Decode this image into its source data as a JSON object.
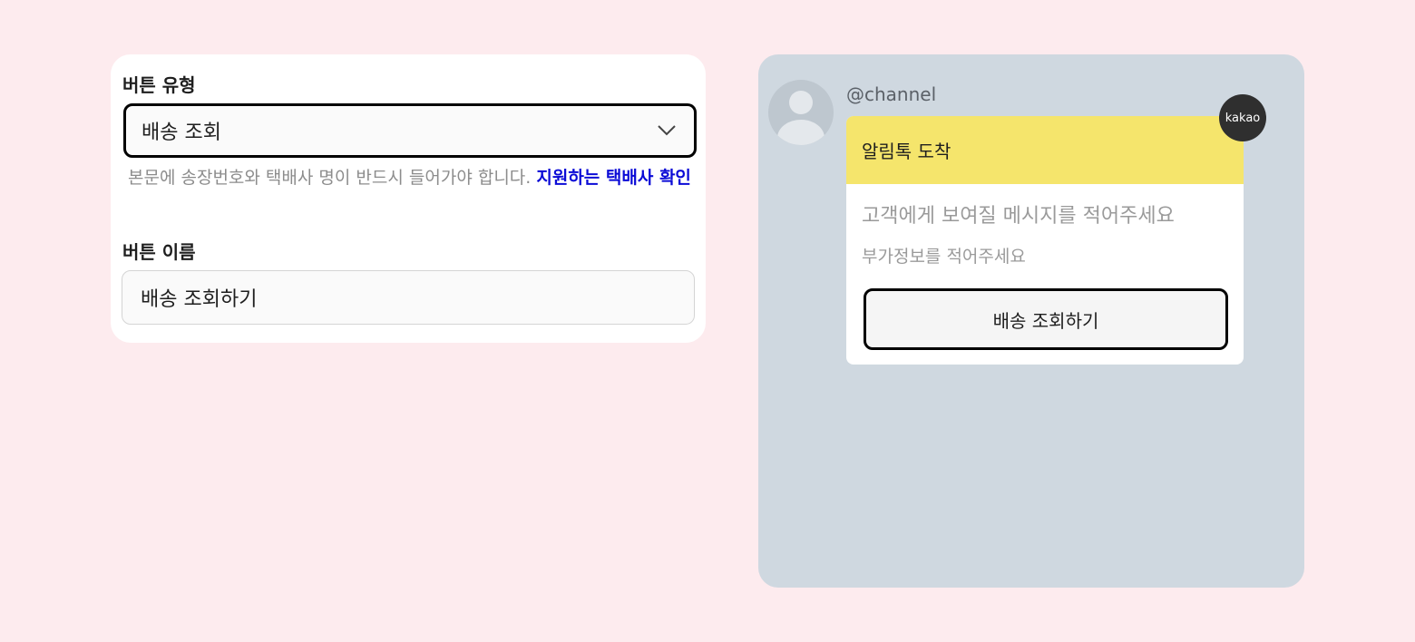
{
  "form": {
    "button_type_label": "버튼 유형",
    "button_type_value": "배송 조회",
    "helper_text": "본문에 송장번호와 택배사 명이 반드시 들어가야 합니다. ",
    "helper_link": "지원하는 택배사 확인",
    "button_name_label": "버튼 이름",
    "button_name_value": "배송 조회하기"
  },
  "preview": {
    "channel": "@channel",
    "badge": "kakao",
    "header": "알림톡 도착",
    "message_placeholder": "고객에게 보여질 메시지를 적어주세요",
    "extra_placeholder": "부가정보를 적어주세요",
    "button_label": "배송 조회하기"
  },
  "colors": {
    "page_background": "#fdebee",
    "preview_background": "#cfd8e0",
    "bubble_header": "#f5e56c",
    "link": "#0a0ad6"
  },
  "icons": {
    "select_chevron": "chevron-down-icon",
    "avatar": "default-profile-icon"
  }
}
